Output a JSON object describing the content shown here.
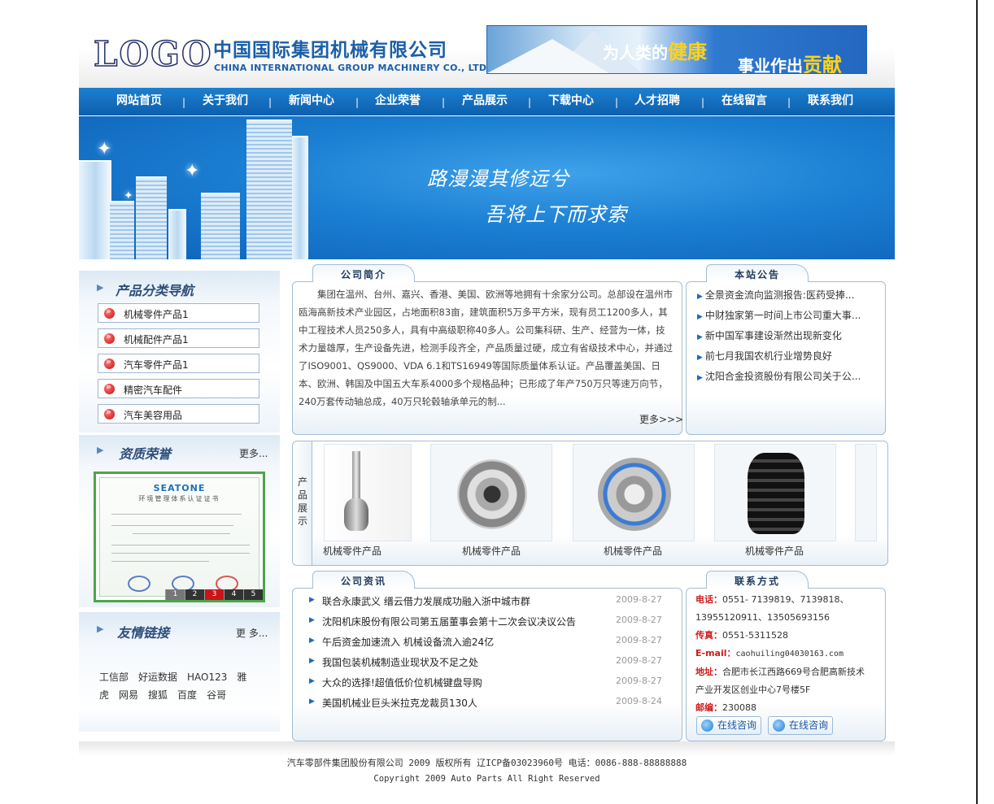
{
  "header": {
    "logo": "LOGO",
    "company_cn": "中国国际集团机械有限公司",
    "company_en": "CHINA INTERNATIONAL GROUP MACHINERY CO., LTD.",
    "banner": {
      "part1": "为人类的",
      "hl1": "健康",
      "part2": "事业作出",
      "hl2": "贡献"
    }
  },
  "nav": {
    "items": [
      "网站首页",
      "关于我们",
      "新闻中心",
      "企业荣誉",
      "产品展示",
      "下载中心",
      "人才招聘",
      "在线留言",
      "联系我们"
    ],
    "separator": "|"
  },
  "hero": {
    "line1": "路漫漫其修远兮",
    "line2": "吾将上下而求索"
  },
  "categories": {
    "title": "产品分类导航",
    "items": [
      "机械零件产品1",
      "机械配件产品1",
      "汽车零件产品1",
      "精密汽车配件",
      "汽车美容用品"
    ]
  },
  "honors": {
    "title": "资质荣誉",
    "more": "更多...",
    "cert_brand": "SEATONE",
    "cert_subtitle": "环境管理体系认证证书",
    "pager": [
      "1",
      "2",
      "3",
      "4",
      "5"
    ],
    "active_page": "3"
  },
  "friend_links": {
    "title": "友情链接",
    "more": "更 多...",
    "items": [
      "工信部",
      "好运数据",
      "HAO123",
      "雅虎",
      "网易",
      "搜狐",
      "百度",
      "谷哥"
    ]
  },
  "intro": {
    "tab": "公司简介",
    "text": "集团在温州、台州、嘉兴、香港、美国、欧洲等地拥有十余家分公司。总部设在温州市瓯海高新技术产业园区，占地面积83亩，建筑面积5万多平方米，现有员工1200多人，其中工程技术人员250多人，具有中高级职称40多人。公司集科研、生产、经营为一体，技术力量雄厚，生产设备先进，检测手段齐全，产品质量过硬，成立有省级技术中心，并通过了ISO9001、QS9000、VDA 6.1和TS16949等国际质量体系认证。产品覆盖美国、日本、欧洲、韩国及中国五大车系4000多个规格品种；已形成了年产750万只等速万向节，240万套传动轴总成，40万只轮毂轴承单元的制...",
    "more": "更多>>>"
  },
  "notices": {
    "tab": "本站公告",
    "items": [
      "全景资金流向监测报告:医药受捧...",
      "中财独家第一时间上市公司重大事...",
      "新中国军事建设渐然出现新变化",
      "前七月我国农机行业增势良好",
      "沈阳合金投资股份有限公司关于公..."
    ]
  },
  "products": {
    "side_label": "产品展示",
    "items": [
      {
        "label": "机械零件产品",
        "icon": "cv-axle-image"
      },
      {
        "label": "机械零件产品",
        "icon": "cv-joint-image"
      },
      {
        "label": "机械零件产品",
        "icon": "wheel-hub-image"
      },
      {
        "label": "机械零件产品",
        "icon": "rubber-boot-image"
      }
    ]
  },
  "news": {
    "tab": "公司资讯",
    "items": [
      {
        "title": "联合永康武义 缙云借力发展成功融入浙中城市群",
        "date": "2009-8-27"
      },
      {
        "title": "沈阳机床股份有限公司第五届董事会第十二次会议决议公告",
        "date": "2009-8-27"
      },
      {
        "title": "午后资金加速流入 机械设备流入逾24亿",
        "date": "2009-8-27"
      },
      {
        "title": "我国包装机械制造业现状及不足之处",
        "date": "2009-8-27"
      },
      {
        "title": "大众的选择!超值低价位机械键盘导购",
        "date": "2009-8-27"
      },
      {
        "title": "美国机械业巨头米拉克龙裁员130人",
        "date": "2009-8-24"
      }
    ]
  },
  "contact": {
    "tab": "联系方式",
    "phone_label": "电话：",
    "phone": "0551- 7139819、7139818、13955120911、13505693156",
    "fax_label": "传真：",
    "fax": "0551-5311528",
    "email_label": "E-mail：",
    "email": "caohuiling04030163.com",
    "address_label": "地址：",
    "address": "合肥市长江西路669号合肥高新技术产业开发区创业中心7号楼5F",
    "zip_label": "邮编：",
    "zip": "230088",
    "chat_buttons": [
      "在线咨询",
      "在线咨询"
    ]
  },
  "footer": {
    "line1": "汽车零部件集团股份有限公司 2009 版权所有 辽ICP备03023960号 电话：0086-888-88888888",
    "line2": "Copyright 2009 Auto Parts All Right Reserved"
  },
  "colors": {
    "nav": "#0c5fae",
    "accent_red": "#d01a1a",
    "border": "#a4bdd4"
  }
}
